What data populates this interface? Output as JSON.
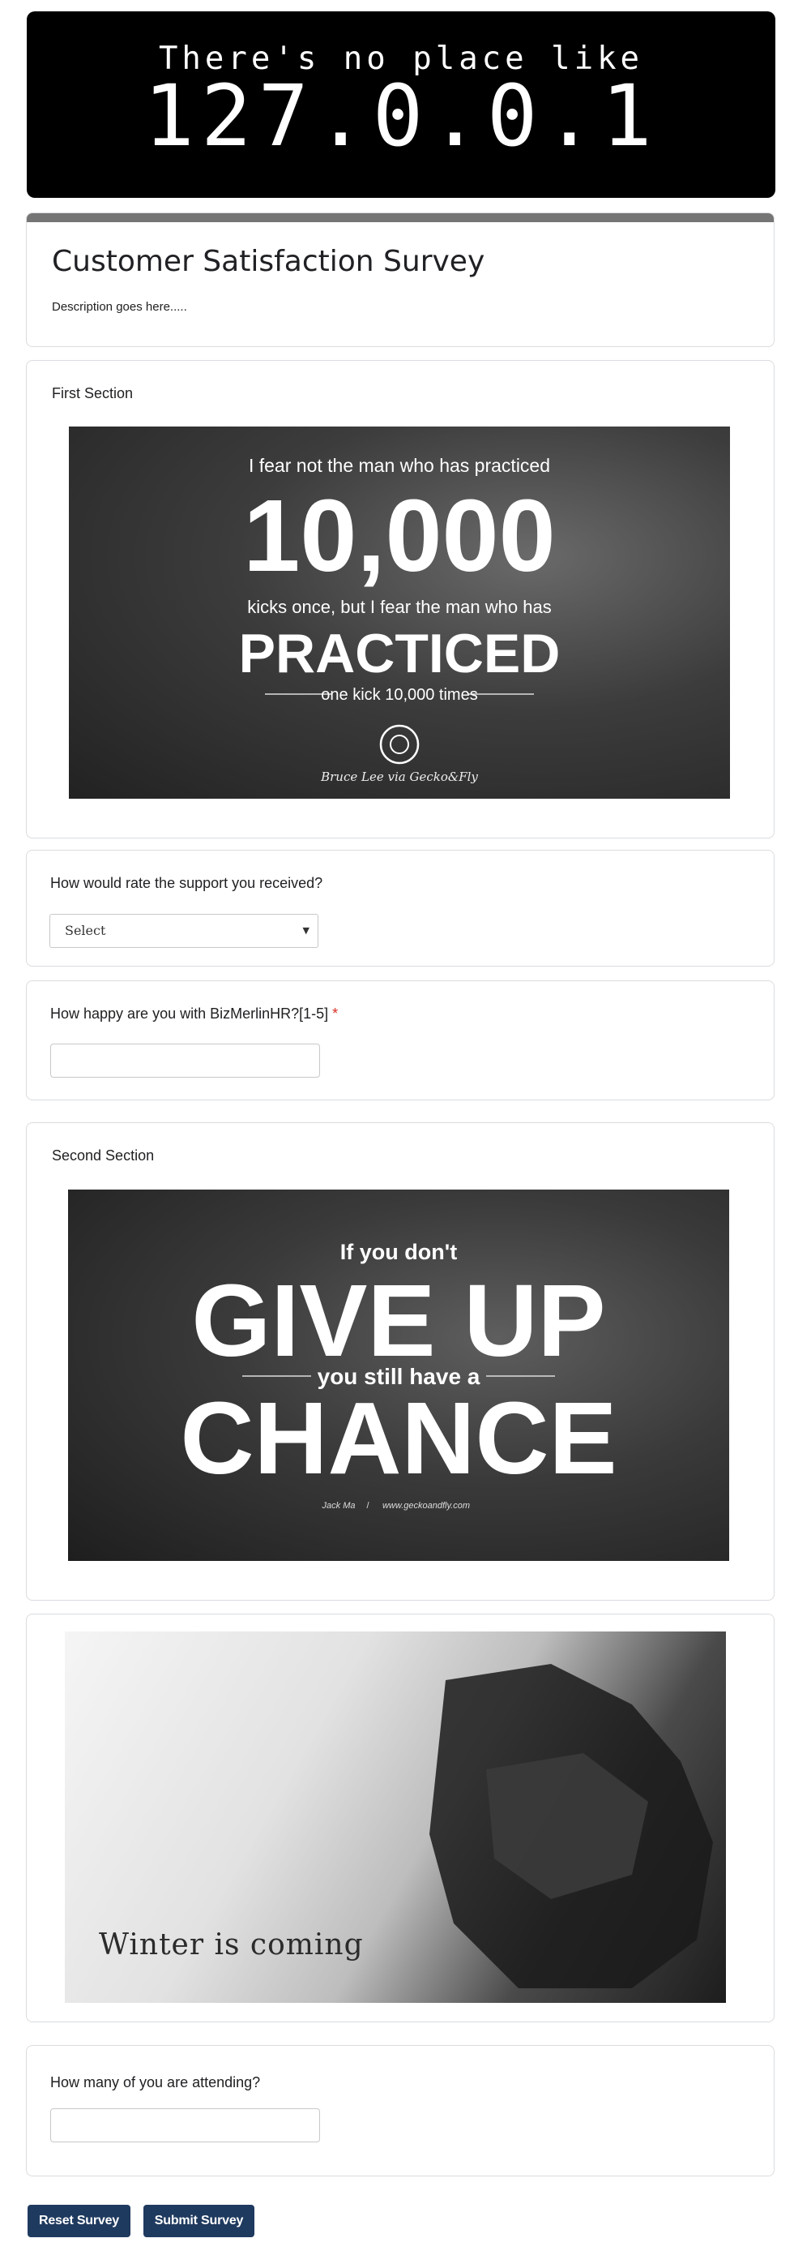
{
  "banner": {
    "line1": "There's no place like",
    "line2": "127.0.0.1"
  },
  "form": {
    "title": "Customer Satisfaction Survey",
    "description": "Description goes here....."
  },
  "section1": {
    "title": "First Section",
    "image_quote": {
      "line1": "I fear not the man who has practiced",
      "big": "10,000",
      "line2": "kicks once, but I fear the man who has",
      "practiced": "PRACTICED",
      "line3": "one kick 10,000 times",
      "credit": "Bruce Lee via Gecko&Fly"
    }
  },
  "q1": {
    "text": "How would rate the support you  received?",
    "select_value": "Select"
  },
  "q2": {
    "text": "How happy are you  with BizMerlinHR?[1-5]",
    "required_mark": "*",
    "value": ""
  },
  "section2": {
    "title": "Second Section",
    "image_quote": {
      "line1": "If you don't",
      "big1": "GIVE UP",
      "line2": "you still have a",
      "big2": "CHANCE",
      "credit_name": "Jack Ma",
      "credit_sep": "/",
      "credit_site": "www.geckoandfly.com"
    }
  },
  "image3": {
    "caption": "Winter is coming"
  },
  "q3": {
    "text": "How many of you are attending?",
    "value": ""
  },
  "buttons": {
    "reset": "Reset Survey",
    "submit": "Submit Survey"
  },
  "colors": {
    "button_bg": "#1f3a5f",
    "required": "#d93025",
    "title_bar": "#757575"
  }
}
